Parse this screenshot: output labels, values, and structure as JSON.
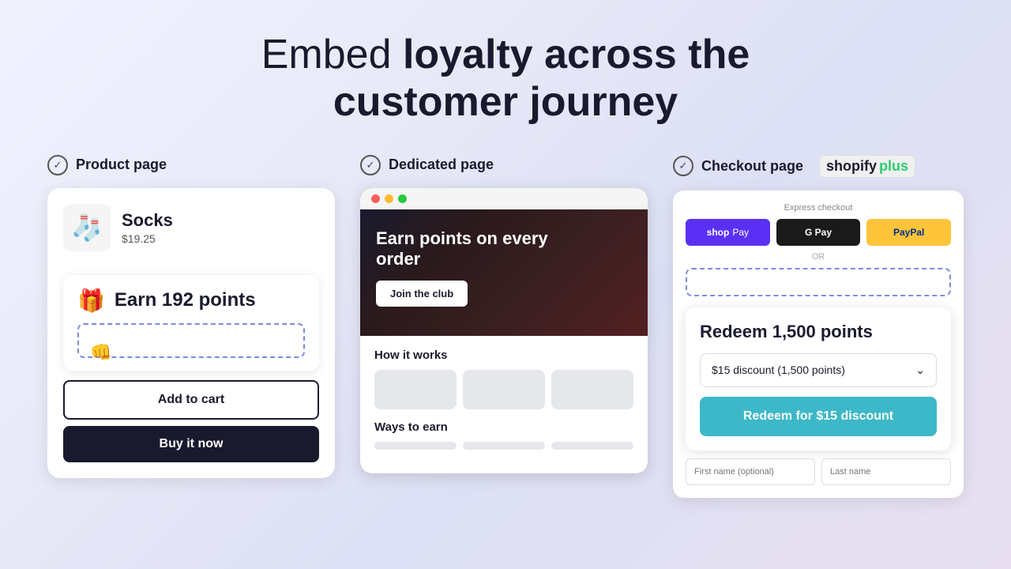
{
  "headline": {
    "prefix": "Embed ",
    "bold": "loyalty across the",
    "line2": "customer journey"
  },
  "columns": [
    {
      "id": "product-page",
      "label": "Product page",
      "product": {
        "name": "Socks",
        "price": "$19.25",
        "icon": "🧦"
      },
      "widget": {
        "earn_text": "Earn 192 points"
      },
      "buttons": {
        "add_to_cart": "Add to cart",
        "buy_now": "Buy it now"
      }
    },
    {
      "id": "dedicated-page",
      "label": "Dedicated page",
      "hero": {
        "title": "Earn points on every order",
        "join_btn": "Join the club"
      },
      "sections": {
        "how_it_works": "How it works",
        "ways_to_earn": "Ways to earn"
      }
    },
    {
      "id": "checkout-page",
      "label": "Checkout page",
      "shopify_plus": "shopify",
      "express": "Express checkout",
      "or_text": "OR",
      "payment_buttons": {
        "shop": "shop Pay",
        "gpay": "G Pay",
        "paypal": "PayPal"
      },
      "redeem": {
        "title": "Redeem 1,500 points",
        "discount_label": "$15 discount (1,500 points)",
        "cta": "Redeem for $15 discount"
      },
      "form": {
        "first_name": "First name (optional)",
        "last_name": "Last name"
      }
    }
  ],
  "colors": {
    "accent_blue": "#3db8c8",
    "dark_navy": "#1a1a2e",
    "dashed_border": "#7b8cde",
    "shopify_purple": "#5a31f4",
    "paypal_yellow": "#ffc439"
  }
}
